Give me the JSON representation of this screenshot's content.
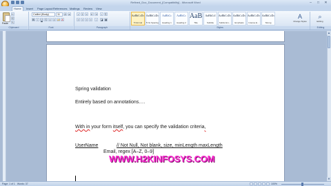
{
  "window": {
    "title": "Refined_Doc_Document_[Compatibility] - Microsoft Word",
    "controls": [
      "–",
      "□",
      "✕"
    ]
  },
  "tabs": [
    {
      "label": "Home",
      "active": true
    },
    {
      "label": "Insert"
    },
    {
      "label": "Page Layout"
    },
    {
      "label": "References"
    },
    {
      "label": "Mailings"
    },
    {
      "label": "Review"
    },
    {
      "label": "View"
    }
  ],
  "ribbon": {
    "paste_label": "Paste",
    "font_name": "Calibri (Body)",
    "font_size": "11",
    "groups": [
      "Clipboard",
      "Font",
      "Paragraph",
      "Styles",
      "Editing"
    ],
    "styles": [
      {
        "sample": "AaBbCcDc",
        "name": "¶ Normal",
        "selected": true
      },
      {
        "sample": "AaBbCcDc",
        "name": "¶ No Spacing"
      },
      {
        "sample": "AaBbCc",
        "name": "Heading 1",
        "blue": true
      },
      {
        "sample": "AaBbCc",
        "name": "Heading 2",
        "blue": true
      },
      {
        "sample": "AaB",
        "name": "Title",
        "big": true
      },
      {
        "sample": "AaBbCcI",
        "name": "Subtitle"
      },
      {
        "sample": "AaBbCcDc",
        "name": "Subtle Em..."
      },
      {
        "sample": "AaBbCcDc",
        "name": "Emphasis"
      },
      {
        "sample": "AaBbCcDc",
        "name": "Intense E..."
      },
      {
        "sample": "AaBbCcDc",
        "name": "Strong"
      }
    ],
    "change_styles": "Change Styles",
    "editing": "Editing"
  },
  "document": {
    "line1": "Spring validation",
    "line2": "Entirely based on annotations….",
    "line3": {
      "a": "With in",
      "b": " your form ",
      "c": "itself",
      "d": ", you can specify the validation criteria",
      "e": ","
    },
    "line4": {
      "field": "UserName",
      "comment": "// Not Null, Not blank, size,  minLength maxLength"
    },
    "line5": "Email, regex [A–Z, 0–9]"
  },
  "watermark": "WWW.H2KINFOSYS.COM",
  "status": {
    "page": "Page: 1 of 1",
    "words": "Words: 37",
    "zoom": "100%"
  }
}
